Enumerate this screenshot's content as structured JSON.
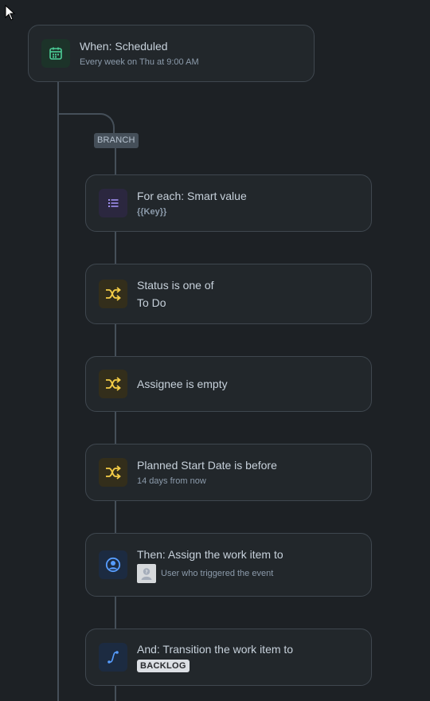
{
  "colors": {
    "background": "#1d2125",
    "card": "#22272b",
    "connector": "#454f59",
    "green": "#4bce97",
    "purple": "#9f8fef",
    "yellow": "#f5cd47",
    "blue": "#579dff"
  },
  "trigger": {
    "icon": "calendar-icon",
    "title": "When: Scheduled",
    "subtitle": "Every week on Thu at 9:00 AM"
  },
  "branch": {
    "badge": "BRANCH",
    "for_each": {
      "icon": "list-icon",
      "title": "For each: Smart value",
      "subtitle": "{{Key}}"
    }
  },
  "conditions": [
    {
      "icon": "shuffle-icon",
      "title": "Status is one of",
      "detail": "To Do"
    },
    {
      "icon": "shuffle-icon",
      "title": "Assignee is empty"
    },
    {
      "icon": "shuffle-icon",
      "title": "Planned Start Date is before",
      "subtitle": "14 days from now"
    }
  ],
  "actions": [
    {
      "icon": "user-circle-icon",
      "title": "Then: Assign the work item to",
      "user_label": "User who triggered the event"
    },
    {
      "icon": "transition-icon",
      "title": "And: Transition the work item to",
      "status": "BACKLOG"
    }
  ]
}
